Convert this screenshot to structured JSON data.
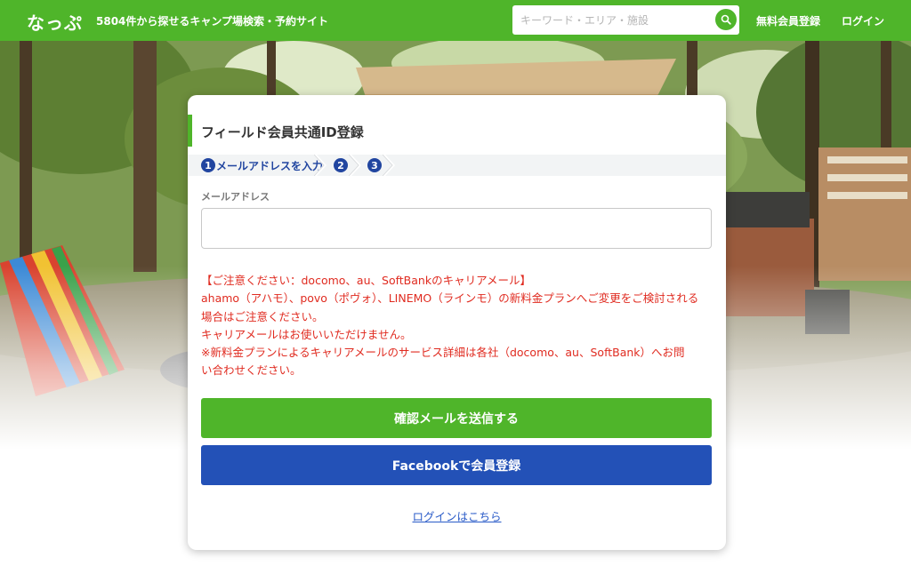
{
  "header": {
    "logo": "なっぷ",
    "tagline": "5804件から探せるキャンプ場検索・予約サイト",
    "search_placeholder": "キーワード・エリア・施設",
    "signup_link": "無料会員登録",
    "login_link": "ログイン"
  },
  "card": {
    "title": "フィールド会員共通ID登録",
    "steps": [
      {
        "number": "1",
        "label": "メールアドレスを入力",
        "active": true
      },
      {
        "number": "2",
        "label": "",
        "active": false
      },
      {
        "number": "3",
        "label": "",
        "active": false
      }
    ],
    "email_label": "メールアドレス",
    "email_value": "",
    "notice_lines": [
      "【ご注意ください：docomo、au、SoftBankのキャリアメール】",
      "ahamo（アハモ）、povo（ポヴォ）、LINEMO（ラインモ）の新料金プランへご変更をご検討される",
      "場合はご注意ください。",
      "キャリアメールはお使いいただけません。",
      "※新料金プランによるキャリアメールのサービス詳細は各社（docomo、au、SoftBank）へお問",
      "い合わせください。"
    ],
    "confirm_button": "確認メールを送信する",
    "facebook_button": "Facebookで会員登録",
    "login_link": "ログインはこちら"
  },
  "colors": {
    "brand_green": "#4fb52a",
    "facebook_blue": "#2351b7",
    "warning_red": "#e02b20",
    "step_blue": "#2145a0",
    "link_blue": "#2a5bc8"
  }
}
